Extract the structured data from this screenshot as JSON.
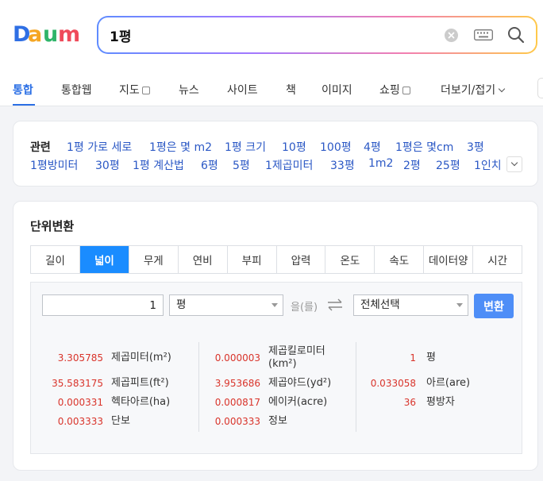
{
  "logo": {
    "text": "Daum"
  },
  "search": {
    "query": "1평"
  },
  "nav": {
    "tabs": [
      "통합",
      "통합웹",
      "지도",
      "뉴스",
      "사이트",
      "책",
      "이미지",
      "쇼핑",
      "더보기/접기"
    ],
    "active": "통합"
  },
  "related": {
    "label": "관련",
    "row1": [
      "1평 가로 세로",
      "1평은 몇 m2",
      "1평 크기",
      "10평",
      "100평",
      "4평",
      "1평은 몇cm",
      "3평"
    ],
    "row2": [
      "1평방미터",
      "30평",
      "1평 계산법",
      "6평",
      "5평",
      "1제곱미터",
      "33평",
      "1m2",
      "2평",
      "25평",
      "1인치"
    ]
  },
  "converter": {
    "title": "단위변환",
    "tabs": [
      "길이",
      "넓이",
      "무게",
      "연비",
      "부피",
      "압력",
      "온도",
      "속도",
      "데이터양",
      "시간"
    ],
    "active_tab": "넓이",
    "input_value": "1",
    "from_unit": "평",
    "particle": "을(를)",
    "to_unit": "전체선택",
    "button": "변환",
    "results": [
      {
        "value": "3.305785",
        "unit": "제곱미터(m²)"
      },
      {
        "value": "35.583175",
        "unit": "제곱피트(ft²)"
      },
      {
        "value": "0.000331",
        "unit": "헥타아르(ha)"
      },
      {
        "value": "0.003333",
        "unit": "단보"
      },
      {
        "value": "0.000003",
        "unit": "제곱킬로미터(km²)"
      },
      {
        "value": "3.953686",
        "unit": "제곱야드(yd²)"
      },
      {
        "value": "0.000817",
        "unit": "에이커(acre)"
      },
      {
        "value": "0.000333",
        "unit": "정보"
      },
      {
        "value": "1",
        "unit": "평"
      },
      {
        "value": "0.033058",
        "unit": "아르(are)"
      },
      {
        "value": "36",
        "unit": "평방자"
      }
    ]
  },
  "colors": {
    "accent": "#1a8cff",
    "link": "#2b58c5",
    "result_value": "#d9342b",
    "button": "#4e8ef7"
  }
}
